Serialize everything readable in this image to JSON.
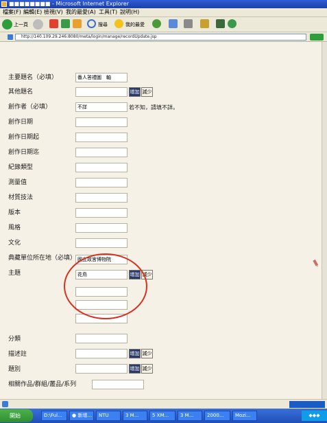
{
  "window": {
    "title": "■■■■■■■■ - Microsoft Internet Explorer"
  },
  "menu": [
    "檔案(F)",
    "編輯(E)",
    "檢視(V)",
    "我的最愛(A)",
    "工具(T)",
    "說明(H)"
  ],
  "toolbar": {
    "back_label": "上一頁",
    "search_label": "搜尋",
    "favorites_label": "我的最愛"
  },
  "address": {
    "url": "http://140.109.29.246:8080/meta/login/manage/recordUpdate.jsp"
  },
  "form": {
    "rows": [
      {
        "label": "主要題名（必填）",
        "value": "番人答禮圖　軸"
      },
      {
        "label": "其他題名",
        "value": ""
      },
      {
        "label": "創作者（必填）",
        "value": "不詳"
      },
      {
        "label": "創作日期",
        "value": ""
      },
      {
        "label": "創作日期起",
        "value": ""
      },
      {
        "label": "創作日期迄",
        "value": ""
      },
      {
        "label": "紀錄類型",
        "value": ""
      },
      {
        "label": "測量值",
        "value": ""
      },
      {
        "label": "材質技法",
        "value": ""
      },
      {
        "label": "版本",
        "value": ""
      },
      {
        "label": "風格",
        "value": ""
      },
      {
        "label": "文化",
        "value": ""
      },
      {
        "label": "典藏單位所在地（必填）",
        "value": "國立故宮博物院"
      },
      {
        "label": "主題",
        "value": "花鳥"
      },
      {
        "label": "分類",
        "value": ""
      },
      {
        "label": "描述註",
        "value": ""
      },
      {
        "label": "題別",
        "value": ""
      },
      {
        "label": "相關作品/群組/叢品/系列",
        "value": ""
      }
    ],
    "add_label": "增加",
    "remove_label": "減少",
    "creator_note": "若不知，請填不詳。"
  },
  "taskbar": {
    "start_label": "開始",
    "tasks": [
      "D:\\Ful...",
      "● 新增...",
      "NTU",
      "3 M...",
      "5 XM...",
      "3 M...",
      "2000...",
      "Mozi..."
    ],
    "clock": "◆◆◆"
  },
  "colors": {
    "highlight_circle": "#d9301f",
    "page_bg": "#f5f1e6"
  }
}
